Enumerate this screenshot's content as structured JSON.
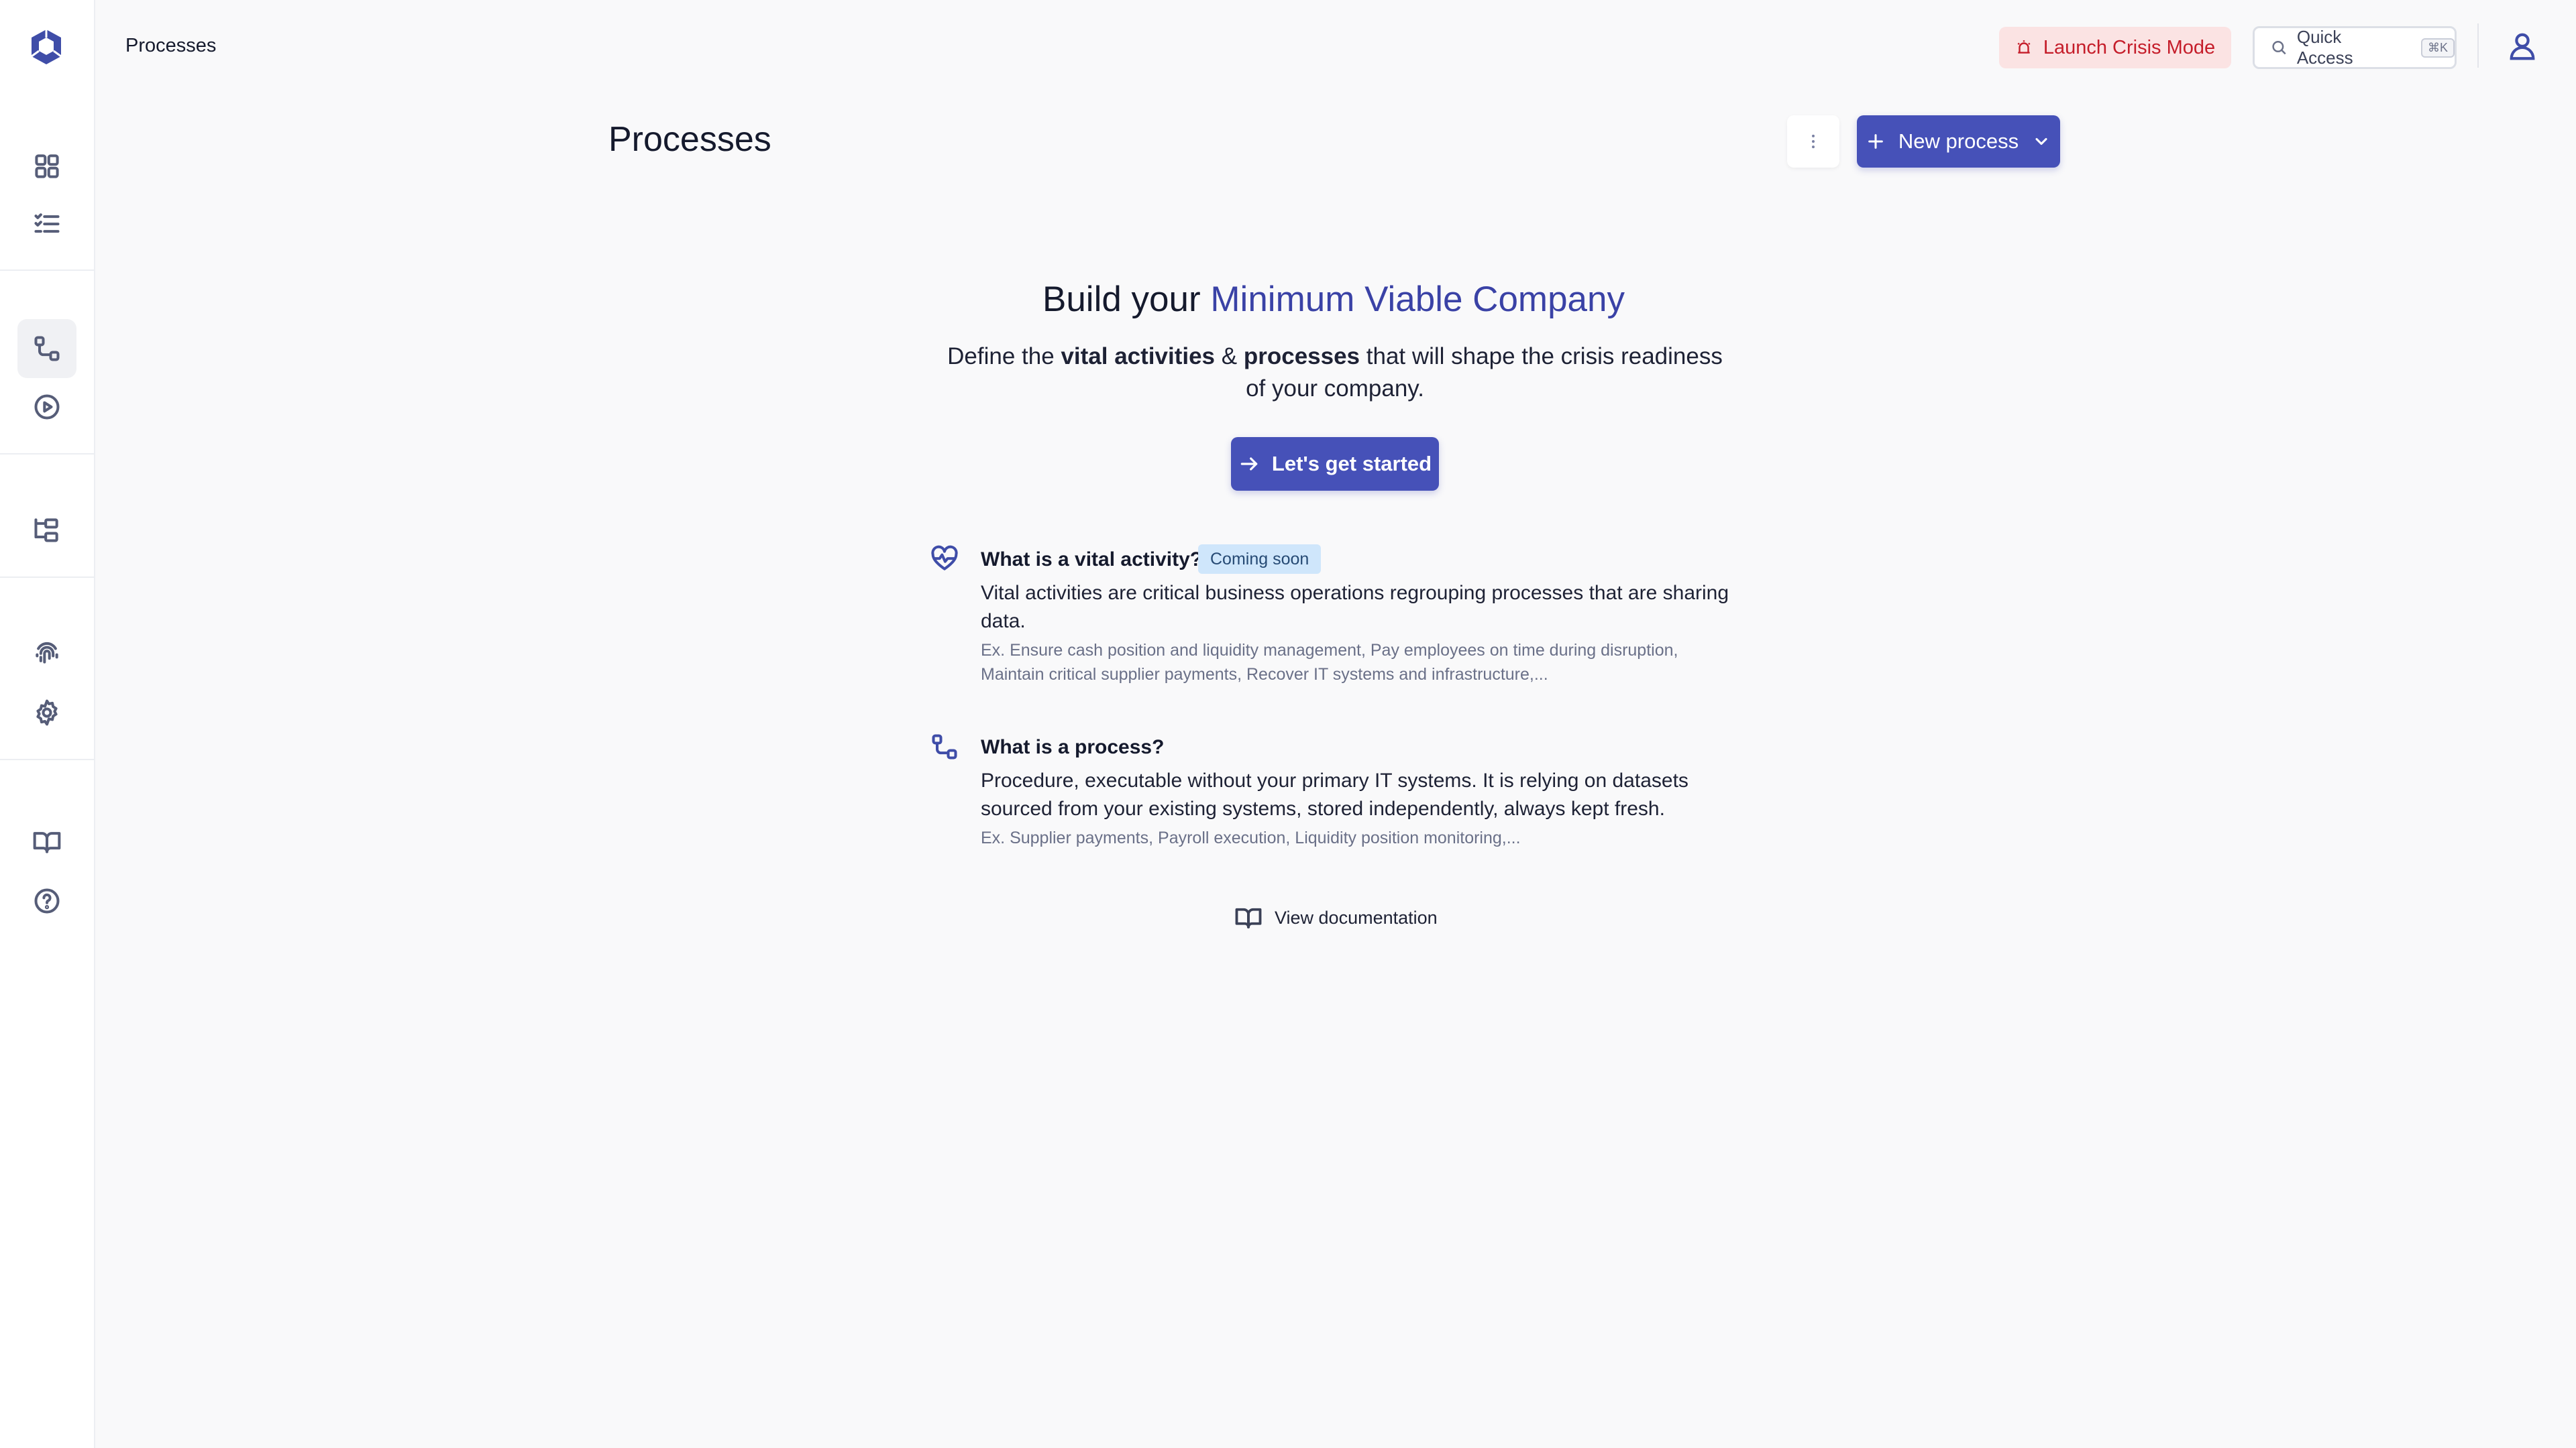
{
  "breadcrumb": "Processes",
  "header": {
    "crisis_label": "Launch Crisis Mode",
    "quick_access_label": "Quick Access",
    "quick_access_shortcut": "⌘K"
  },
  "page": {
    "title": "Processes",
    "new_process_label": "New process"
  },
  "hero": {
    "title_prefix": "Build your",
    "title_accent": "Minimum Viable Company",
    "sub_part1": "Define the",
    "sub_bold1": "vital activities",
    "sub_amp": "&",
    "sub_bold2": "processes",
    "sub_part2": "that will shape the crisis readiness of your company.",
    "cta_label": "Let's get started"
  },
  "info_vital": {
    "title": "What is a vital activity?",
    "badge": "Coming soon",
    "description": "Vital activities are critical business operations regrouping processes that are sharing data.",
    "example": "Ex. Ensure cash position and liquidity management, Pay employees on time during disruption, Maintain critical supplier payments, Recover IT systems and infrastructure,..."
  },
  "info_process": {
    "title": "What is a process?",
    "description": "Procedure, executable without your primary IT systems. It is relying on datasets sourced from your existing systems, stored independently, always kept fresh.",
    "example": "Ex. Supplier payments, Payroll execution, Liquidity position monitoring,..."
  },
  "docs_link_label": "View documentation",
  "colors": {
    "accent": "#4651b8",
    "accent_text": "#3a42a6",
    "crisis_bg": "#fbe3e3",
    "crisis_text": "#c51d2a",
    "badge_bg": "#cfe6fb"
  },
  "icons": {
    "sidebar": [
      "dashboard-grid-icon",
      "checklist-icon",
      "process-flow-icon",
      "play-circle-icon",
      "hierarchy-icon",
      "fingerprint-icon",
      "settings-gear-icon",
      "book-icon",
      "help-circle-icon"
    ],
    "info": [
      "heart-pulse-icon",
      "process-flow-icon"
    ]
  }
}
